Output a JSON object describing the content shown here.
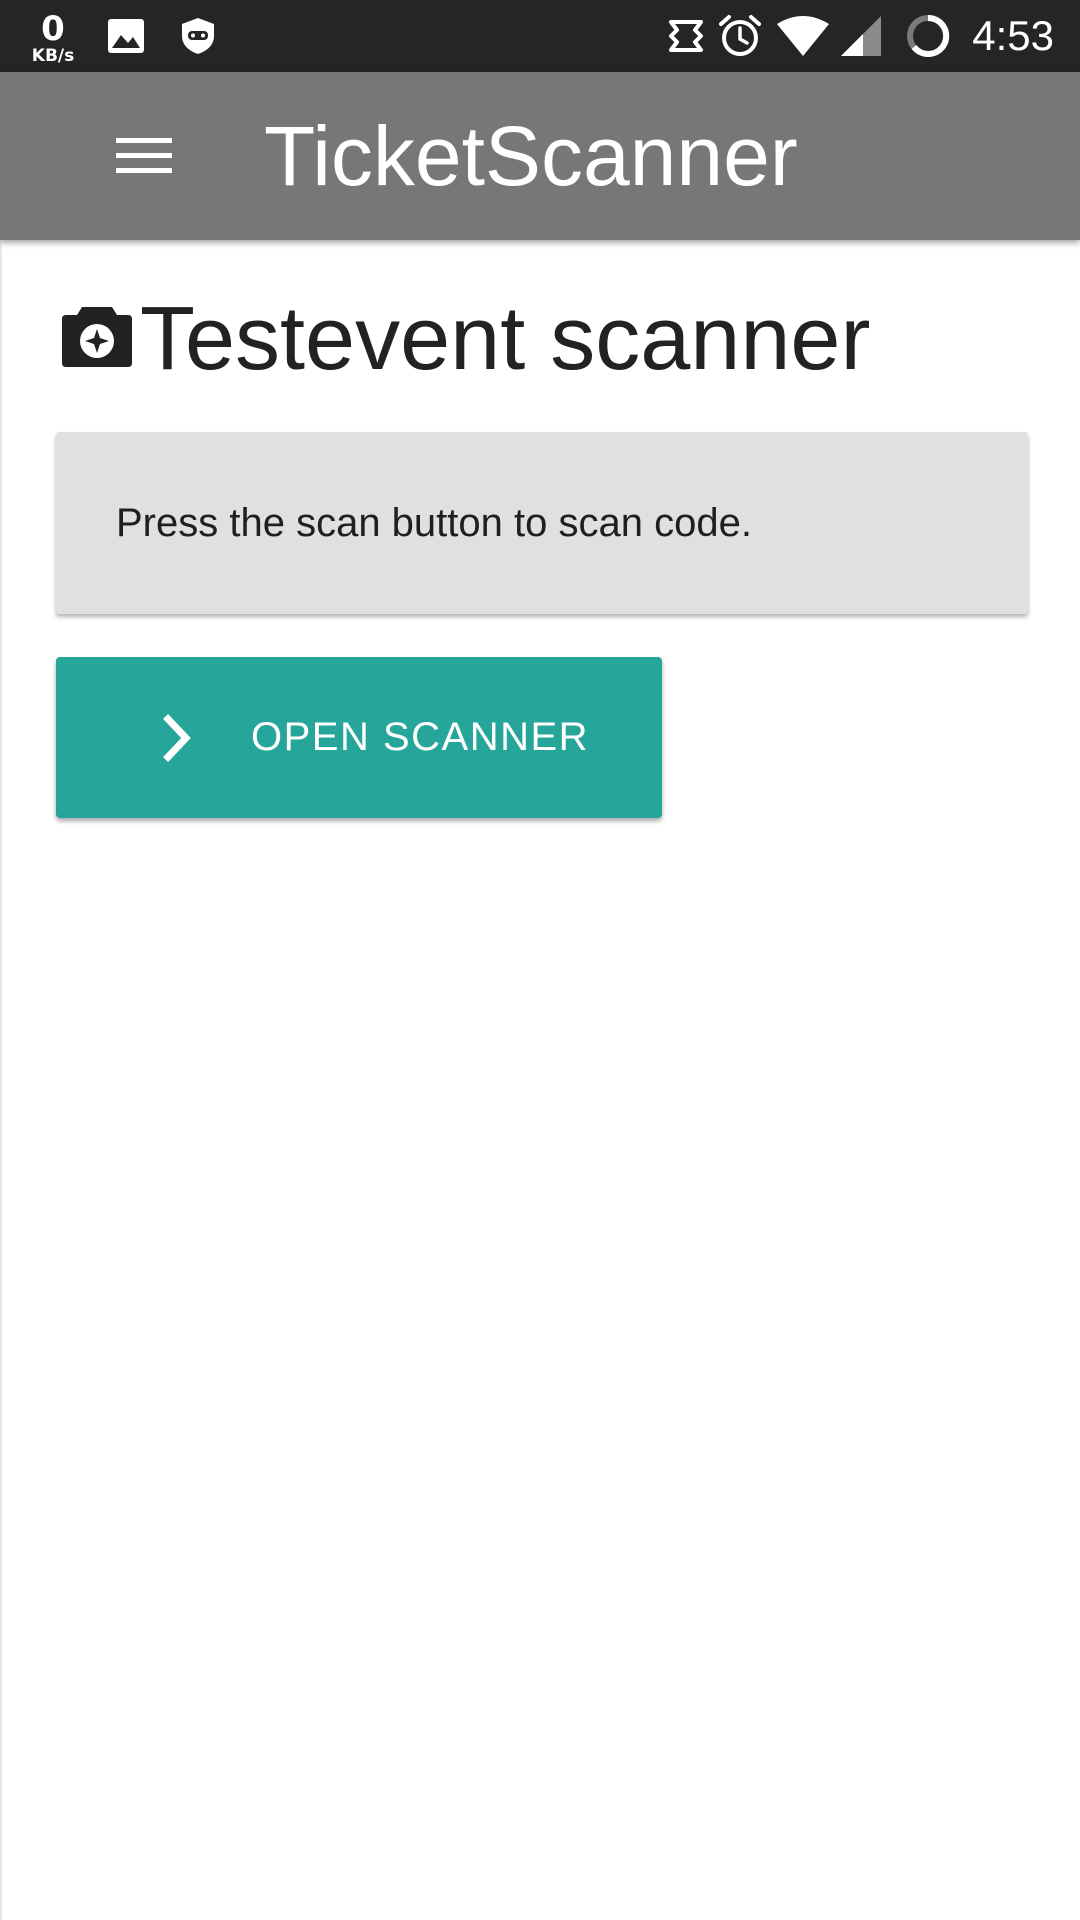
{
  "status_bar": {
    "net_speed_value": "0",
    "net_speed_unit": "KB/s",
    "time": "4:53",
    "icons": [
      "gallery-icon",
      "shield-icon",
      "sync-icon",
      "alarm-icon",
      "wifi-icon",
      "signal-icon",
      "battery-icon"
    ]
  },
  "app_bar": {
    "title": "TicketScanner",
    "menu_icon": "hamburger-menu-icon",
    "background_color": "#777777"
  },
  "main": {
    "heading_icon": "camera-icon",
    "heading": "Testevent scanner",
    "info_message": "Press the scan button to scan code.",
    "scan_button": {
      "icon": "chevron-right-icon",
      "label": "OPEN SCANNER",
      "color": "#26a69a"
    }
  }
}
